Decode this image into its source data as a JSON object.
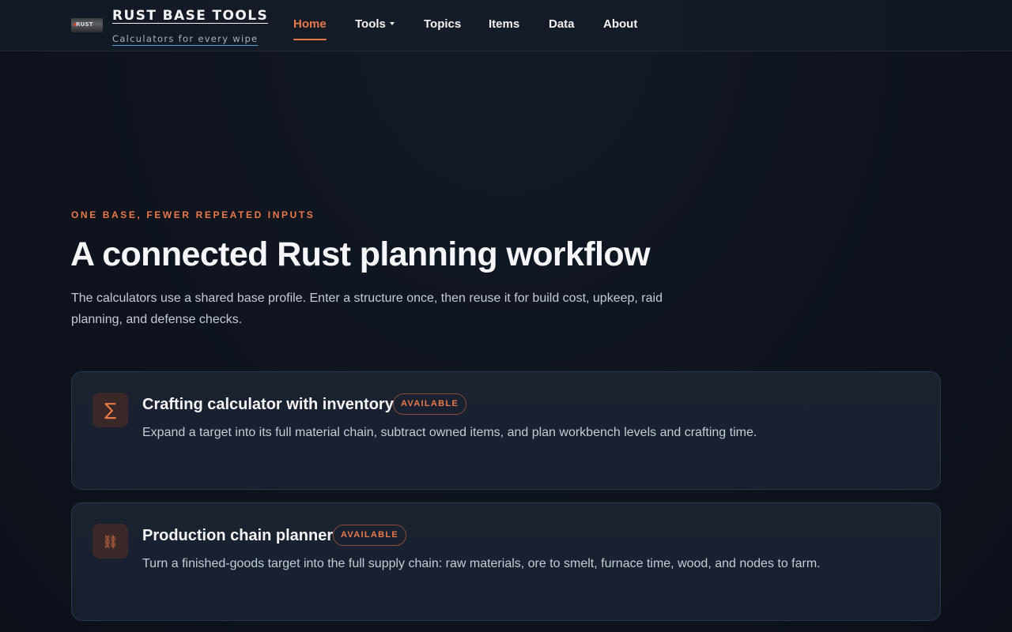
{
  "header": {
    "logo_text": "RUST",
    "brand_title": "RUST BASE TOOLS",
    "brand_subtitle": "Calculators for every wipe",
    "nav": [
      {
        "label": "Home",
        "active": true
      },
      {
        "label": "Tools",
        "dropdown": true
      },
      {
        "label": "Topics"
      },
      {
        "label": "Items"
      },
      {
        "label": "Data"
      },
      {
        "label": "About"
      }
    ]
  },
  "hero": {
    "eyebrow": "ONE BASE, FEWER REPEATED INPUTS",
    "title": "A connected Rust planning workflow",
    "description": "The calculators use a shared base profile. Enter a structure once, then reuse it for build cost, upkeep, raid planning, and defense checks."
  },
  "cards": [
    {
      "icon": "sigma-icon",
      "icon_glyph": "∑",
      "title": "Crafting calculator with inventory",
      "badge": "AVAILABLE",
      "description": "Expand a target into its full material chain, subtract owned items, and plan workbench levels and crafting time."
    },
    {
      "icon": "chain-link-icon",
      "icon_glyph": "⛓",
      "title": "Production chain planner",
      "badge": "AVAILABLE",
      "description": "Turn a finished-goods target into the full supply chain: raw materials, ore to smelt, furnace time, wood, and nodes to farm."
    }
  ],
  "colors": {
    "accent": "#e8794b",
    "background": "#0e131d",
    "card": "#1a2230"
  }
}
